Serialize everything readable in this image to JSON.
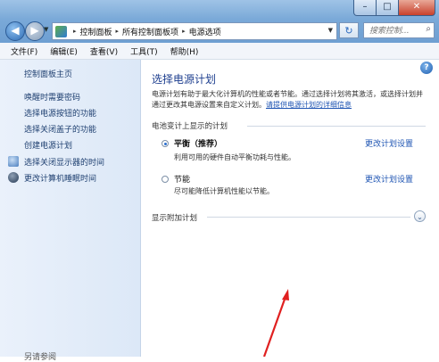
{
  "window": {
    "min": "–",
    "max": "□",
    "close": "✕"
  },
  "nav": {
    "back": "◀",
    "forward": "▶",
    "drop": "▼"
  },
  "address": {
    "crumbs": [
      "控制面板",
      "所有控制面板项",
      "电源选项"
    ],
    "sep": "▸",
    "dropdown": "▼",
    "refresh": "↻"
  },
  "search": {
    "placeholder": "搜索控制...",
    "icon": "⌕"
  },
  "menu": [
    "文件(F)",
    "编辑(E)",
    "查看(V)",
    "工具(T)",
    "帮助(H)"
  ],
  "sidebar": {
    "home": "控制面板主页",
    "links": [
      "唤醒时需要密码",
      "选择电源按钮的功能",
      "选择关闭盖子的功能",
      "创建电源计划",
      "选择关闭显示器的时间",
      "更改计算机睡眠时间"
    ],
    "footer": "另请参阅"
  },
  "main": {
    "help": "?",
    "title": "选择电源计划",
    "desc_text": "电源计划有助于最大化计算机的性能或者节能。通过选择计划将其激活，或选择计划并通过更改其电源设置来自定义计划。",
    "desc_link": "请提供电源计划的详细信息",
    "group_label": "电池变计上显示的计划",
    "plans": [
      {
        "name": "平衡（推荐）",
        "desc": "利用可用的硬件自动平衡功耗与性能。",
        "link": "更改计划设置",
        "selected": true
      },
      {
        "name": "节能",
        "desc": "尽可能降低计算机性能以节能。",
        "link": "更改计划设置",
        "selected": false
      }
    ],
    "extra_label": "显示附加计划",
    "expander": "⌄"
  },
  "colors": {
    "link": "#1f55b3",
    "title": "#1e3f8f",
    "arrow": "#e02020"
  }
}
